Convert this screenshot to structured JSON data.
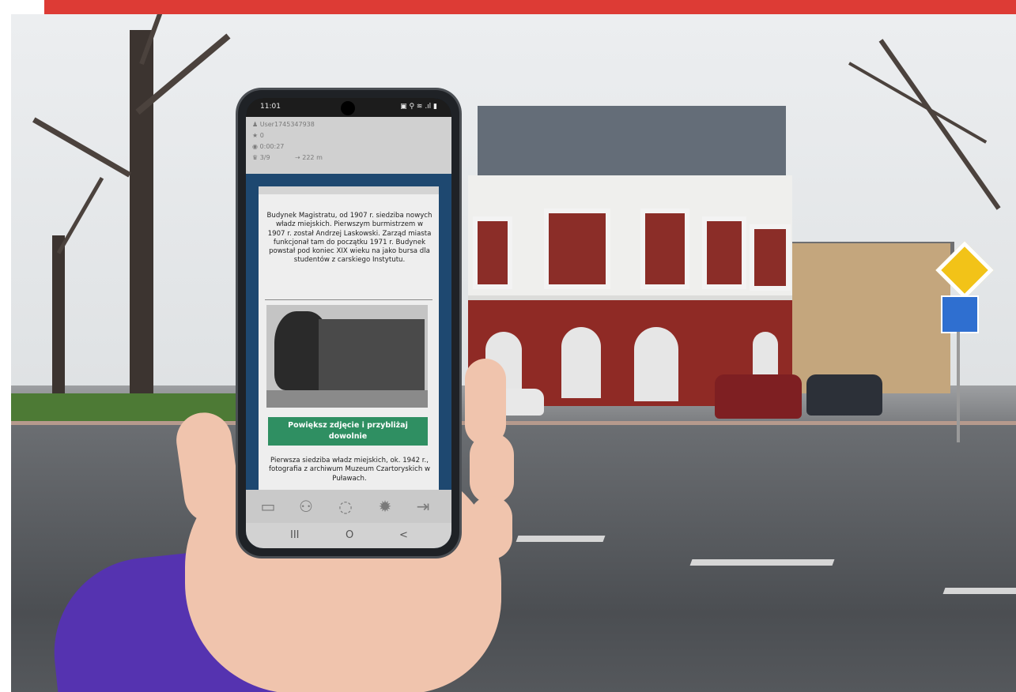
{
  "phone": {
    "status_time": "11:01",
    "status_icons": "▣ ⚲ ≋ .ıl ▮",
    "user": "User1745347938",
    "stars": "0",
    "elapsed": "0:00:27",
    "progress": "3/9",
    "distance": "222 m",
    "description": "Budynek Magistratu, od 1907 r. siedziba nowych władz miejskich. Pierwszym burmistrzem w 1907 r. został Andrzej Laskowski. Zarząd miasta funkcjonał tam do początku 1971 r. Budynek powstał pod koniec XIX wieku na jako bursa dla studentów z carskiego Instytutu.",
    "zoom_button": "Powiększ zdjęcie i przybliżaj dowolnie",
    "caption": "Pierwsza siedziba władz miejskich, ok. 1942 r., fotografia z archiwum Muzeum Czartoryskich w Puławach.",
    "tabs": [
      "briefcase-icon",
      "team-icon",
      "chat-icon",
      "settings-icon",
      "exit-icon"
    ],
    "nav": [
      "III",
      "O",
      "<"
    ]
  },
  "colors": {
    "top_bar": "#dd3b35",
    "button": "#2f8f62",
    "screen_bg": "#1e4870",
    "sleeve": "#5533b0"
  }
}
